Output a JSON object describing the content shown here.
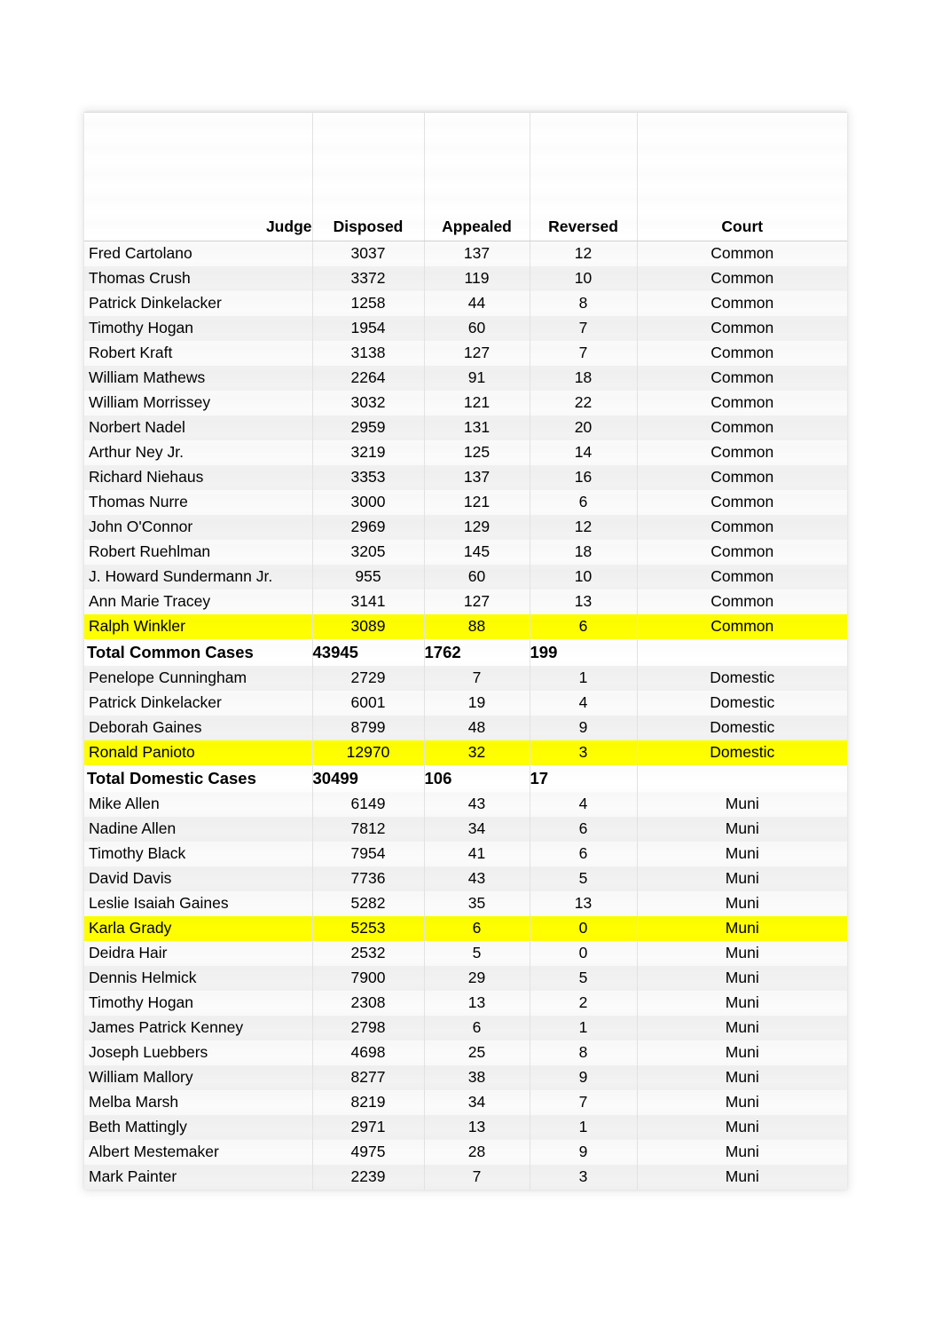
{
  "table": {
    "columns": [
      {
        "key": "judge",
        "label": "Judge"
      },
      {
        "key": "disposed",
        "label": "Disposed"
      },
      {
        "key": "appealed",
        "label": "Appealed"
      },
      {
        "key": "reversed",
        "label": "Reversed"
      },
      {
        "key": "court",
        "label": "Court"
      }
    ],
    "highlight_color": "#FFFF00",
    "rows": [
      {
        "judge": "Fred Cartolano",
        "disposed": "3037",
        "appealed": "137",
        "reversed": "12",
        "court": "Common",
        "type": "data",
        "highlight": false
      },
      {
        "judge": "Thomas Crush",
        "disposed": "3372",
        "appealed": "119",
        "reversed": "10",
        "court": "Common",
        "type": "data",
        "highlight": false
      },
      {
        "judge": "Patrick Dinkelacker",
        "disposed": "1258",
        "appealed": "44",
        "reversed": "8",
        "court": "Common",
        "type": "data",
        "highlight": false
      },
      {
        "judge": "Timothy Hogan",
        "disposed": "1954",
        "appealed": "60",
        "reversed": "7",
        "court": "Common",
        "type": "data",
        "highlight": false
      },
      {
        "judge": "Robert Kraft",
        "disposed": "3138",
        "appealed": "127",
        "reversed": "7",
        "court": "Common",
        "type": "data",
        "highlight": false
      },
      {
        "judge": "William Mathews",
        "disposed": "2264",
        "appealed": "91",
        "reversed": "18",
        "court": "Common",
        "type": "data",
        "highlight": false
      },
      {
        "judge": "William Morrissey",
        "disposed": "3032",
        "appealed": "121",
        "reversed": "22",
        "court": "Common",
        "type": "data",
        "highlight": false
      },
      {
        "judge": "Norbert Nadel",
        "disposed": "2959",
        "appealed": "131",
        "reversed": "20",
        "court": "Common",
        "type": "data",
        "highlight": false
      },
      {
        "judge": "Arthur Ney Jr.",
        "disposed": "3219",
        "appealed": "125",
        "reversed": "14",
        "court": "Common",
        "type": "data",
        "highlight": false
      },
      {
        "judge": "Richard Niehaus",
        "disposed": "3353",
        "appealed": "137",
        "reversed": "16",
        "court": "Common",
        "type": "data",
        "highlight": false
      },
      {
        "judge": "Thomas Nurre",
        "disposed": "3000",
        "appealed": "121",
        "reversed": "6",
        "court": "Common",
        "type": "data",
        "highlight": false
      },
      {
        "judge": "John O'Connor",
        "disposed": "2969",
        "appealed": "129",
        "reversed": "12",
        "court": "Common",
        "type": "data",
        "highlight": false
      },
      {
        "judge": "Robert Ruehlman",
        "disposed": "3205",
        "appealed": "145",
        "reversed": "18",
        "court": "Common",
        "type": "data",
        "highlight": false
      },
      {
        "judge": "J. Howard Sundermann Jr.",
        "disposed": "955",
        "appealed": "60",
        "reversed": "10",
        "court": "Common",
        "type": "data",
        "highlight": false
      },
      {
        "judge": "Ann Marie Tracey",
        "disposed": "3141",
        "appealed": "127",
        "reversed": "13",
        "court": "Common",
        "type": "data",
        "highlight": false
      },
      {
        "judge": "Ralph Winkler",
        "disposed": "3089",
        "appealed": "88",
        "reversed": "6",
        "court": "Common",
        "type": "data",
        "highlight": true
      },
      {
        "judge": "Total Common Cases",
        "disposed": "43945",
        "appealed": "1762",
        "reversed": "199",
        "court": "",
        "type": "total",
        "highlight": false
      },
      {
        "judge": "Penelope Cunningham",
        "disposed": "2729",
        "appealed": "7",
        "reversed": "1",
        "court": "Domestic",
        "type": "data",
        "highlight": false
      },
      {
        "judge": "Patrick Dinkelacker",
        "disposed": "6001",
        "appealed": "19",
        "reversed": "4",
        "court": "Domestic",
        "type": "data",
        "highlight": false
      },
      {
        "judge": "Deborah Gaines",
        "disposed": "8799",
        "appealed": "48",
        "reversed": "9",
        "court": "Domestic",
        "type": "data",
        "highlight": false
      },
      {
        "judge": "Ronald Panioto",
        "disposed": "12970",
        "appealed": "32",
        "reversed": "3",
        "court": "Domestic",
        "type": "data",
        "highlight": true
      },
      {
        "judge": "Total Domestic Cases",
        "disposed": "30499",
        "appealed": "106",
        "reversed": "17",
        "court": "",
        "type": "total",
        "highlight": false
      },
      {
        "judge": "Mike Allen",
        "disposed": "6149",
        "appealed": "43",
        "reversed": "4",
        "court": "Muni",
        "type": "data",
        "highlight": false
      },
      {
        "judge": "Nadine Allen",
        "disposed": "7812",
        "appealed": "34",
        "reversed": "6",
        "court": "Muni",
        "type": "data",
        "highlight": false
      },
      {
        "judge": "Timothy Black",
        "disposed": "7954",
        "appealed": "41",
        "reversed": "6",
        "court": "Muni",
        "type": "data",
        "highlight": false
      },
      {
        "judge": "David Davis",
        "disposed": "7736",
        "appealed": "43",
        "reversed": "5",
        "court": "Muni",
        "type": "data",
        "highlight": false
      },
      {
        "judge": "Leslie Isaiah Gaines",
        "disposed": "5282",
        "appealed": "35",
        "reversed": "13",
        "court": "Muni",
        "type": "data",
        "highlight": false
      },
      {
        "judge": "Karla Grady",
        "disposed": "5253",
        "appealed": "6",
        "reversed": "0",
        "court": "Muni",
        "type": "data",
        "highlight": true
      },
      {
        "judge": "Deidra Hair",
        "disposed": "2532",
        "appealed": "5",
        "reversed": "0",
        "court": "Muni",
        "type": "data",
        "highlight": false
      },
      {
        "judge": "Dennis Helmick",
        "disposed": "7900",
        "appealed": "29",
        "reversed": "5",
        "court": "Muni",
        "type": "data",
        "highlight": false
      },
      {
        "judge": "Timothy Hogan",
        "disposed": "2308",
        "appealed": "13",
        "reversed": "2",
        "court": "Muni",
        "type": "data",
        "highlight": false
      },
      {
        "judge": "James Patrick Kenney",
        "disposed": "2798",
        "appealed": "6",
        "reversed": "1",
        "court": "Muni",
        "type": "data",
        "highlight": false
      },
      {
        "judge": "Joseph Luebbers",
        "disposed": "4698",
        "appealed": "25",
        "reversed": "8",
        "court": "Muni",
        "type": "data",
        "highlight": false
      },
      {
        "judge": "William Mallory",
        "disposed": "8277",
        "appealed": "38",
        "reversed": "9",
        "court": "Muni",
        "type": "data",
        "highlight": false
      },
      {
        "judge": "Melba Marsh",
        "disposed": "8219",
        "appealed": "34",
        "reversed": "7",
        "court": "Muni",
        "type": "data",
        "highlight": false
      },
      {
        "judge": "Beth Mattingly",
        "disposed": "2971",
        "appealed": "13",
        "reversed": "1",
        "court": "Muni",
        "type": "data",
        "highlight": false
      },
      {
        "judge": "Albert Mestemaker",
        "disposed": "4975",
        "appealed": "28",
        "reversed": "9",
        "court": "Muni",
        "type": "data",
        "highlight": false
      },
      {
        "judge": "Mark Painter",
        "disposed": "2239",
        "appealed": "7",
        "reversed": "3",
        "court": "Muni",
        "type": "data",
        "highlight": false
      }
    ]
  }
}
